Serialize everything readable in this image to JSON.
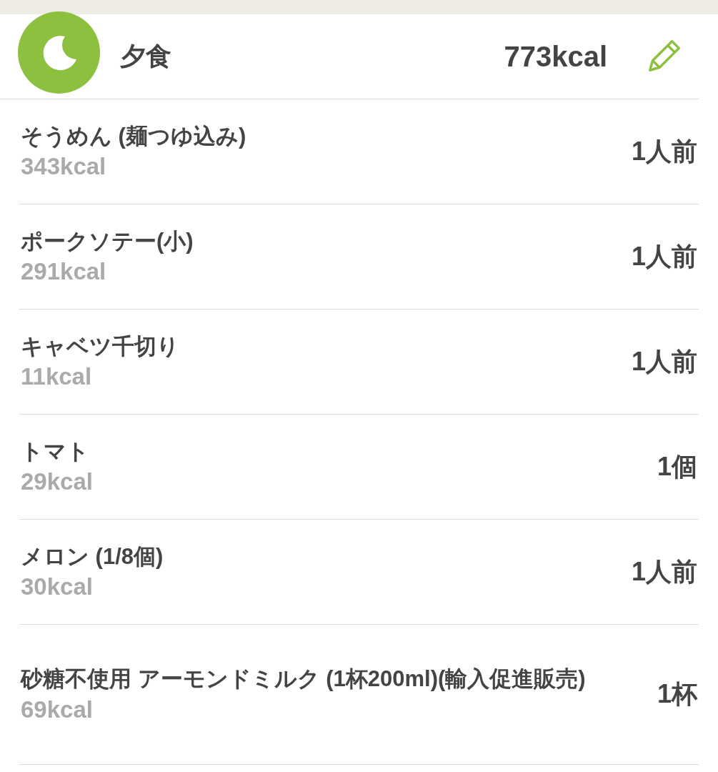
{
  "meal": {
    "title": "夕食",
    "total": "773kcal"
  },
  "items": [
    {
      "name": "そうめん (麺つゆ込み)",
      "kcal": "343kcal",
      "amount": "1人前"
    },
    {
      "name": "ポークソテー(小)",
      "kcal": "291kcal",
      "amount": "1人前"
    },
    {
      "name": "キャベツ千切り",
      "kcal": "11kcal",
      "amount": "1人前"
    },
    {
      "name": "トマト",
      "kcal": "29kcal",
      "amount": "1個"
    },
    {
      "name": "メロン (1/8個)",
      "kcal": "30kcal",
      "amount": "1人前"
    },
    {
      "name": "砂糖不使用 アーモンドミルク (1杯200ml)(輸入促進販売)",
      "kcal": "69kcal",
      "amount": "1杯"
    }
  ]
}
